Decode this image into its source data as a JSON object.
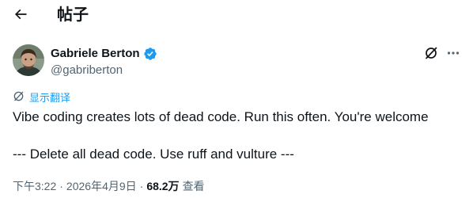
{
  "header": {
    "back_icon": "arrow-left-icon",
    "title": "帖子"
  },
  "author": {
    "display_name": "Gabriele Berton",
    "handle": "@gabriberton",
    "verified": true,
    "verified_color": "#1d9bf0"
  },
  "actions": {
    "grok_icon": "grok-icon",
    "more_icon": "more-horizontal-icon"
  },
  "translate": {
    "label": "显示翻译",
    "icon": "translate-icon"
  },
  "tweet": {
    "lines": [
      "Vibe coding creates lots of dead code. Run this often. You're welcome",
      "--- Delete all dead code. Use ruff and vulture ---"
    ]
  },
  "meta": {
    "time": "下午3:22",
    "separator": "·",
    "date": "2026年4月9日",
    "views_count": "68.2万",
    "views_label": "查看"
  },
  "colors": {
    "text": "#0f1419",
    "secondary": "#536471",
    "accent": "#1d9bf0"
  }
}
